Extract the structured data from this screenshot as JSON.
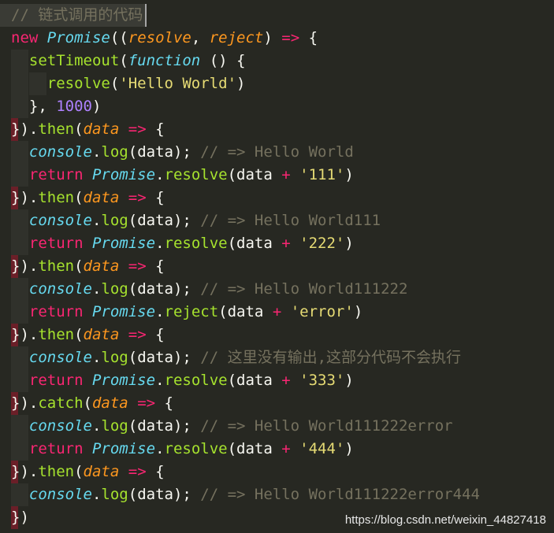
{
  "lines": [
    {
      "text": "// 链式调用的代码"
    },
    {
      "text": "new Promise((resolve, reject) => {"
    },
    {
      "text": "  setTimeout(function () {"
    },
    {
      "text": "    resolve('Hello World')"
    },
    {
      "text": "  }, 1000)"
    },
    {
      "text": "}).then(data => {"
    },
    {
      "text": "  console.log(data); // => Hello World"
    },
    {
      "text": "  return Promise.resolve(data + '111')"
    },
    {
      "text": "}).then(data => {"
    },
    {
      "text": "  console.log(data); // => Hello World111"
    },
    {
      "text": "  return Promise.resolve(data + '222')"
    },
    {
      "text": "}).then(data => {"
    },
    {
      "text": "  console.log(data); // => Hello World111222"
    },
    {
      "text": "  return Promise.reject(data + 'error')"
    },
    {
      "text": "}).then(data => {"
    },
    {
      "text": "  console.log(data); // 这里没有输出,这部分代码不会执行"
    },
    {
      "text": "  return Promise.resolve(data + '333')"
    },
    {
      "text": "}).catch(data => {"
    },
    {
      "text": "  console.log(data); // => Hello World111222error"
    },
    {
      "text": "  return Promise.resolve(data + '444')"
    },
    {
      "text": "}).then(data => {"
    },
    {
      "text": "  console.log(data); // => Hello World111222error444"
    },
    {
      "text": "})"
    }
  ],
  "watermark": "https://blog.csdn.net/weixin_44827418",
  "theme": {
    "background": "#272822",
    "keyword": "#f92672",
    "comment": "#75715e",
    "type": "#66d9ef",
    "function": "#a6e22e",
    "param": "#fd971f",
    "string": "#e6db74",
    "number": "#ae81ff"
  }
}
